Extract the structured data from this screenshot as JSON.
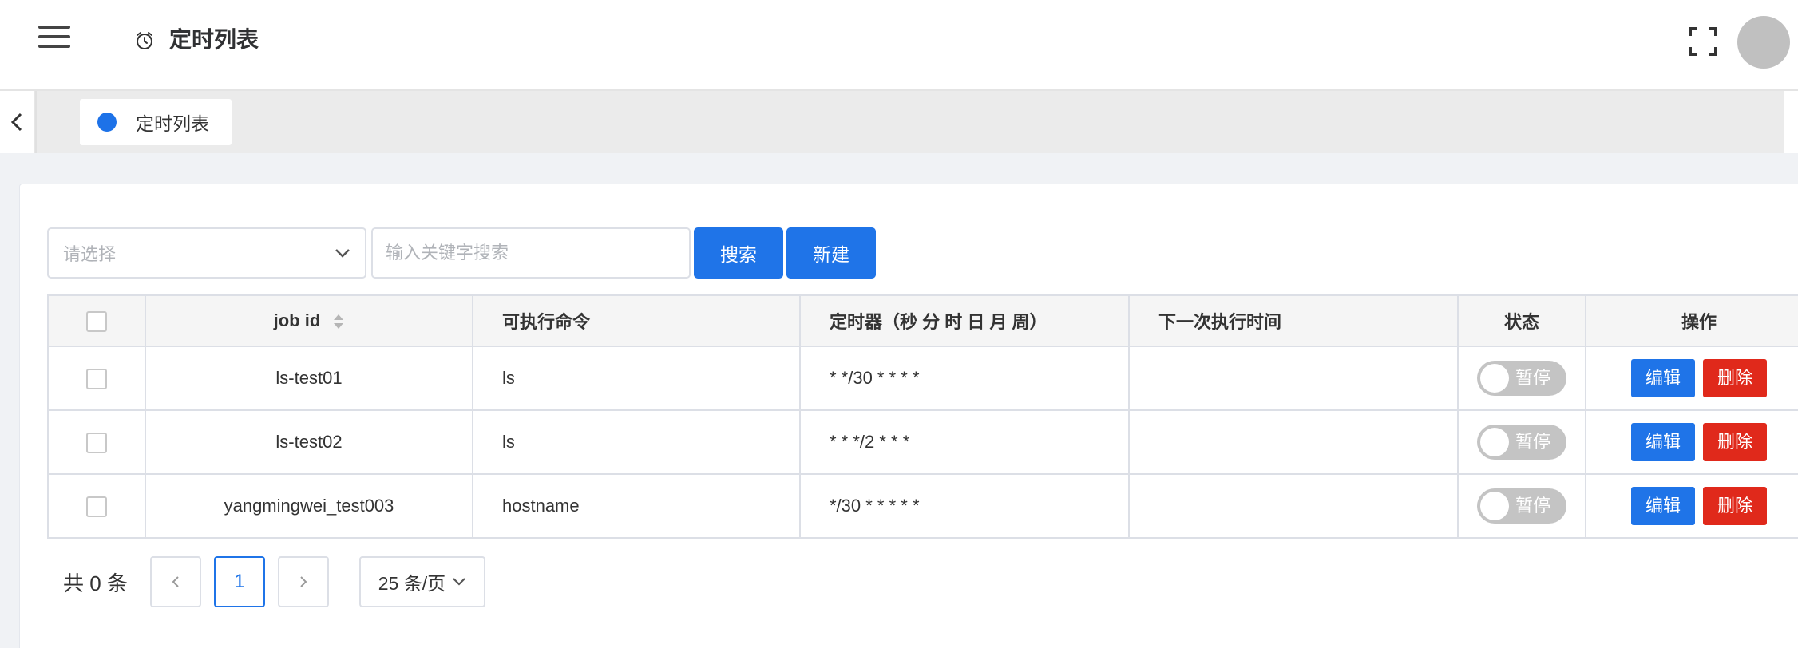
{
  "header": {
    "title": "定时列表"
  },
  "tags": [
    {
      "label": "定时列表"
    }
  ],
  "toolbar": {
    "select_placeholder": "请选择",
    "search_placeholder": "输入关键字搜索",
    "search_label": "搜索",
    "new_label": "新建"
  },
  "table": {
    "headers": {
      "job_id": "job id",
      "command": "可执行命令",
      "timer": "定时器（秒 分 时 日 月 周）",
      "next_run": "下一次执行时间",
      "status": "状态",
      "actions": "操作"
    },
    "rows": [
      {
        "job_id": "ls-test01",
        "command": "ls",
        "timer": "* */30 * * * *",
        "next_run": "",
        "status": "暂停",
        "edit": "编辑",
        "delete": "删除"
      },
      {
        "job_id": "ls-test02",
        "command": "ls",
        "timer": "* * */2 * * *",
        "next_run": "",
        "status": "暂停",
        "edit": "编辑",
        "delete": "删除"
      },
      {
        "job_id": "yangmingwei_test003",
        "command": "hostname",
        "timer": "*/30 * * * * *",
        "next_run": "",
        "status": "暂停",
        "edit": "编辑",
        "delete": "删除"
      }
    ]
  },
  "pagination": {
    "total": "共 0 条",
    "current_page": "1",
    "page_size": "25 条/页"
  },
  "colors": {
    "primary": "#1f74e8",
    "danger": "#e0291b",
    "switch_off": "#c4c4c4"
  }
}
